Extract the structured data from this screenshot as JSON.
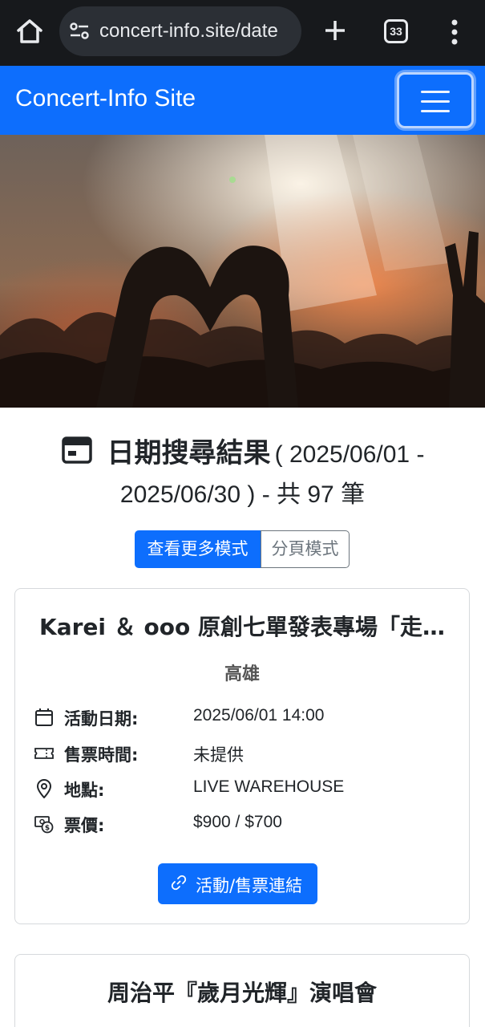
{
  "browser": {
    "url": "concert-info.site/date",
    "tab_count": "33"
  },
  "navbar": {
    "brand": "Concert-Info Site"
  },
  "results": {
    "title": "日期搜尋結果",
    "range_line1": "( 2025/06/01 -",
    "range_line2": "2025/06/30 )  - 共 97 筆"
  },
  "modes": {
    "more": "查看更多模式",
    "paged": "分頁模式"
  },
  "events": [
    {
      "title": "Karei ＆ ooo 原創七單發表專場「走…",
      "city": "高雄",
      "date_label": "活動日期:",
      "date": "2025/06/01 14:00",
      "sale_label": "售票時間:",
      "sale": "未提供",
      "venue_label": "地點:",
      "venue": "LIVE WAREHOUSE",
      "price_label": "票價:",
      "price": "$900 / $700",
      "link_label": "活動/售票連結"
    },
    {
      "title": "周治平『歲月光輝』演唱會"
    }
  ],
  "colors": {
    "primary": "#0d6efd",
    "chrome": "#17191c"
  }
}
